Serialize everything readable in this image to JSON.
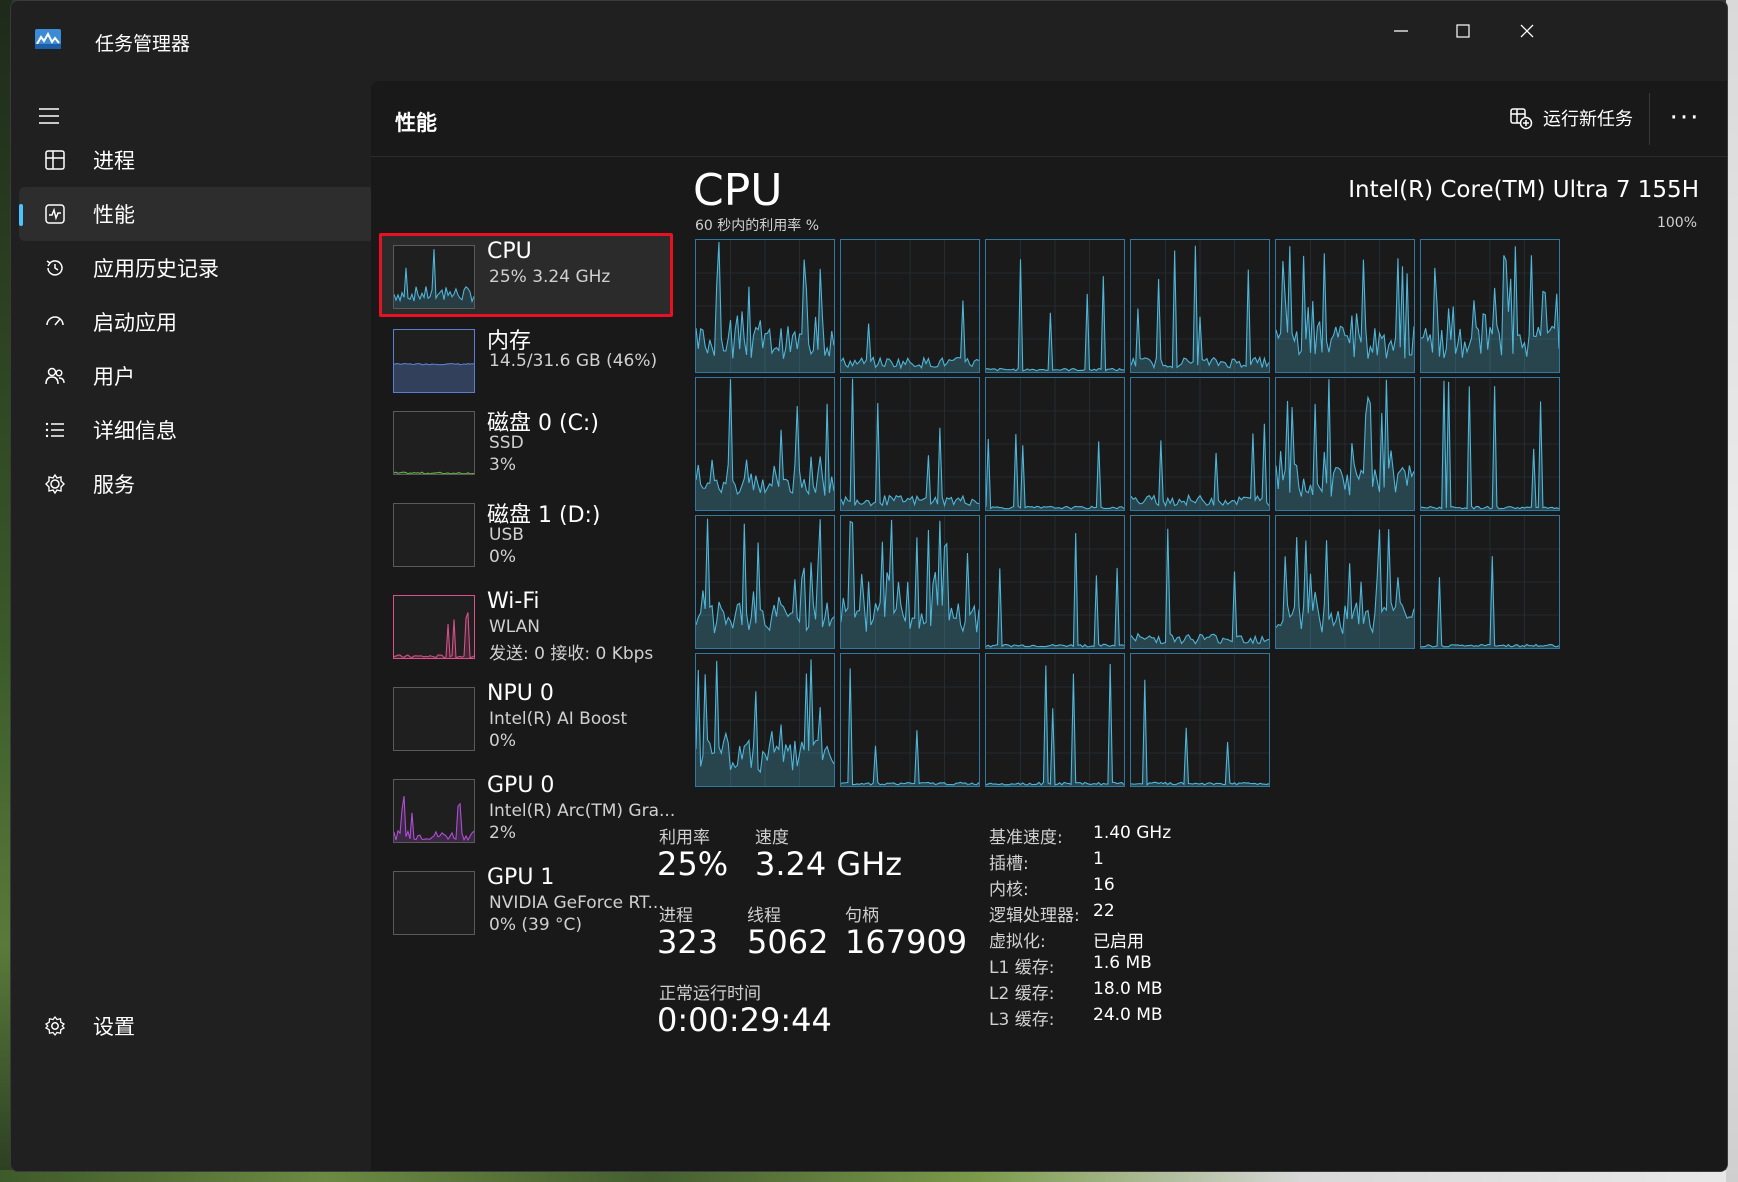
{
  "app": {
    "title": "任务管理器",
    "icon": "task-manager-icon"
  },
  "window_controls": [
    "minimize",
    "maximize",
    "close"
  ],
  "nav": {
    "items": [
      {
        "label": "进程",
        "icon": "processes-icon"
      },
      {
        "label": "性能",
        "icon": "performance-icon",
        "active": true
      },
      {
        "label": "应用历史记录",
        "icon": "history-icon"
      },
      {
        "label": "启动应用",
        "icon": "startup-icon"
      },
      {
        "label": "用户",
        "icon": "users-icon"
      },
      {
        "label": "详细信息",
        "icon": "details-icon"
      },
      {
        "label": "服务",
        "icon": "services-icon"
      }
    ],
    "settings": {
      "label": "设置",
      "icon": "gear-icon"
    }
  },
  "header": {
    "title": "性能",
    "run_task_label": "运行新任务",
    "more_label": "···"
  },
  "devices": [
    {
      "name": "CPU",
      "sub1": "25%  3.24 GHz",
      "sub2": "",
      "sub3": "",
      "color": "#4fb6d9"
    },
    {
      "name": "内存",
      "sub1": "14.5/31.6 GB (46%)",
      "sub2": "",
      "sub3": "",
      "color": "#5a7fcf"
    },
    {
      "name": "磁盘 0 (C:)",
      "sub1": "SSD",
      "sub2": "3%",
      "sub3": "",
      "color": "#6ab04c"
    },
    {
      "name": "磁盘 1 (D:)",
      "sub1": "USB",
      "sub2": "0%",
      "sub3": "",
      "color": "#6ab04c"
    },
    {
      "name": "Wi-Fi",
      "sub1": "WLAN",
      "sub2": "发送: 0 接收: 0 Kbps",
      "sub3": "",
      "color": "#d9508a"
    },
    {
      "name": "NPU 0",
      "sub1": "Intel(R) AI Boost",
      "sub2": "0%",
      "sub3": "",
      "color": "#4fb6d9"
    },
    {
      "name": "GPU 0",
      "sub1": "Intel(R) Arc(TM) Gra...",
      "sub2": "2%",
      "sub3": "",
      "color": "#b14fd9"
    },
    {
      "name": "GPU 1",
      "sub1": "NVIDIA GeForce RT...",
      "sub2": "0% (39 °C)",
      "sub3": "",
      "color": "#b14fd9"
    }
  ],
  "cpu": {
    "title": "CPU",
    "model": "Intel(R) Core(TM) Ultra 7 155H",
    "graph_label": "60 秒内的利用率 %",
    "graph_max": "100%",
    "logical_processors_shown": 22,
    "accent_color": "#4fb6d9",
    "stats": {
      "util_label": "利用率",
      "util_value": "25%",
      "speed_label": "速度",
      "speed_value": "3.24 GHz",
      "proc_label": "进程",
      "proc_value": "323",
      "threads_label": "线程",
      "threads_value": "5062",
      "handles_label": "句柄",
      "handles_value": "167909",
      "uptime_label": "正常运行时间",
      "uptime_value": "0:00:29:44"
    },
    "details": [
      {
        "k": "基准速度:",
        "v": "1.40 GHz"
      },
      {
        "k": "插槽:",
        "v": "1"
      },
      {
        "k": "内核:",
        "v": "16"
      },
      {
        "k": "逻辑处理器:",
        "v": "22"
      },
      {
        "k": "虚拟化:",
        "v": "已启用"
      },
      {
        "k": "L1 缓存:",
        "v": "1.6 MB"
      },
      {
        "k": "L2 缓存:",
        "v": "18.0 MB"
      },
      {
        "k": "L3 缓存:",
        "v": "24.0 MB"
      }
    ]
  }
}
